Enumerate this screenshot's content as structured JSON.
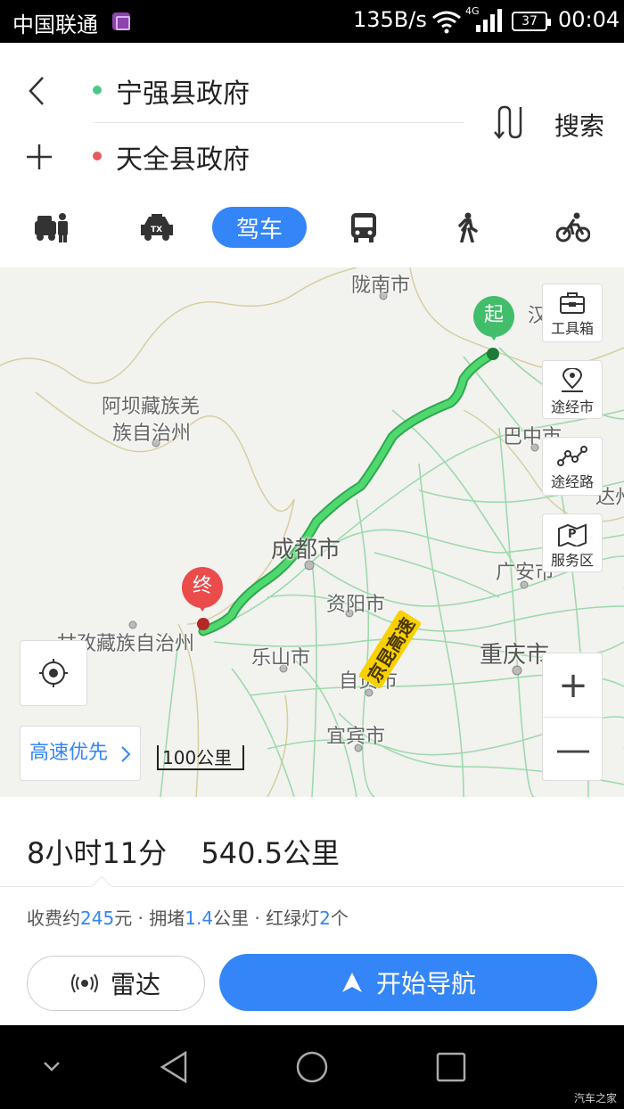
{
  "status_bar": {
    "carrier": "中国联通",
    "net_speed": "135B/s",
    "network_type": "4G",
    "battery": "37",
    "time": "00:04"
  },
  "route": {
    "origin": "宁强县政府",
    "destination": "天全县政府",
    "search_label": "搜索"
  },
  "modes": {
    "active": "驾车"
  },
  "map": {
    "labels": {
      "longnan": "陇南市",
      "aba": "阿坝藏族羌",
      "aba2": "族自治州",
      "bazhong": "巴中市",
      "chengdu": "成都市",
      "guangan": "广安市",
      "ziyang": "资阳市",
      "ganzi": "甘孜藏族自治州",
      "leshan": "乐山市",
      "chongqing": "重庆市",
      "zigong": "自贡市",
      "yibin": "宜宾市",
      "han": "汉",
      "dazhou": "达州"
    },
    "highway": "京昆高速",
    "start_pin": "起",
    "end_pin": "终",
    "tools": {
      "toolbox": "工具箱",
      "via_city": "途经市",
      "via_road": "途经路",
      "service_area": "服务区"
    },
    "preference": "高速优先",
    "scale": "100公里",
    "zoom_in": "+",
    "zoom_out": "—"
  },
  "summary": {
    "duration": "8小时11分",
    "distance": "540.5公里",
    "toll_prefix": "收费约",
    "toll_value": "245",
    "toll_suffix": "元 · 拥堵",
    "jam_value": "1.4",
    "jam_suffix": "公里 · 红绿灯",
    "lights_value": "2",
    "lights_suffix": "个",
    "radar_label": "雷达",
    "navigate_label": "开始导航"
  },
  "watermark": "汽车之家",
  "colors": {
    "accent": "#3485f7",
    "route": "#3ec85a",
    "start": "#42be6a",
    "end": "#ea4b4b"
  }
}
